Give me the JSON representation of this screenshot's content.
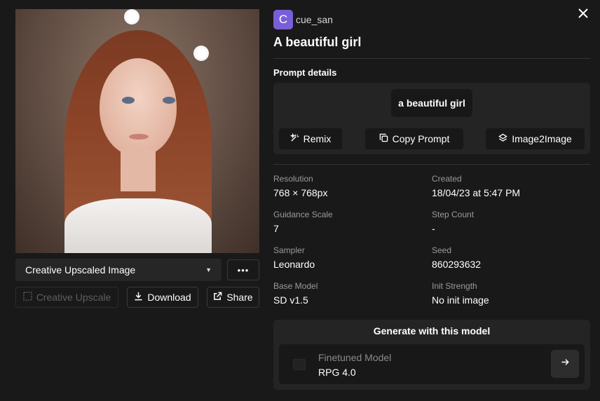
{
  "image": {
    "alt": "",
    "variant_select": {
      "selected": "Creative Upscaled Image"
    },
    "more_label": "•••",
    "actions": {
      "creative_upscale": "Creative Upscale",
      "download": "Download",
      "share": "Share"
    }
  },
  "header": {
    "avatar_letter": "C",
    "username": "cue_san",
    "title": "A beautiful girl"
  },
  "prompt_details": {
    "heading": "Prompt details",
    "prompt": "a beautiful girl",
    "buttons": {
      "remix": "Remix",
      "copy_prompt": "Copy Prompt",
      "image2image": "Image2Image"
    }
  },
  "metadata": {
    "resolution": {
      "label": "Resolution",
      "value": "768 × 768px"
    },
    "created": {
      "label": "Created",
      "value": "18/04/23 at 5:47 PM"
    },
    "guidance_scale": {
      "label": "Guidance Scale",
      "value": "7"
    },
    "step_count": {
      "label": "Step Count",
      "value": "-"
    },
    "sampler": {
      "label": "Sampler",
      "value": "Leonardo"
    },
    "seed": {
      "label": "Seed",
      "value": "860293632"
    },
    "base_model": {
      "label": "Base Model",
      "value": "SD v1.5"
    },
    "init_strength": {
      "label": "Init Strength",
      "value": "No init image"
    }
  },
  "generate": {
    "heading": "Generate with this model",
    "model_type": "Finetuned Model",
    "model_name": "RPG 4.0"
  },
  "colors": {
    "background": "#191919",
    "panel": "#242424",
    "avatar": "#7a5ed8"
  },
  "icons": {
    "close": "close-icon",
    "caret": "chevron-down-icon",
    "remix": "magic-wand-icon",
    "copy": "copy-icon",
    "image2image": "layers-icon",
    "download": "download-icon",
    "share": "share-icon",
    "upscale": "upscale-icon",
    "arrow": "arrow-right-icon"
  }
}
